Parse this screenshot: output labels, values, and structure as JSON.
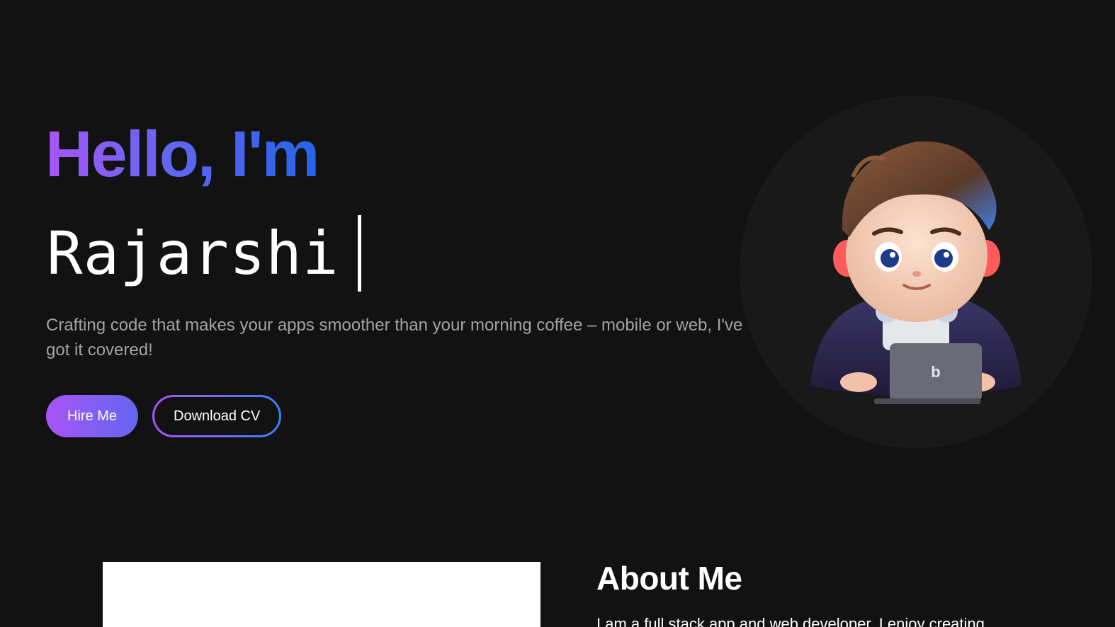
{
  "hero": {
    "greeting": "Hello, I'm",
    "typed_name": "Rajarshi",
    "tagline": "Crafting code that makes your apps smoother than your morning coffee – mobile or web, I've got it covered!",
    "buttons": {
      "hire_label": "Hire Me",
      "download_label": "Download CV"
    },
    "avatar_icon": "cartoon-developer-with-laptop",
    "laptop_logo": "b"
  },
  "about": {
    "title": "About Me",
    "text": "I am a full stack app and web developer. I enjoy creating"
  },
  "colors": {
    "background": "#121212",
    "accent_purple": "#a855f7",
    "accent_indigo": "#6366f1",
    "accent_blue": "#2563eb",
    "muted_text": "#a3a3a3"
  }
}
